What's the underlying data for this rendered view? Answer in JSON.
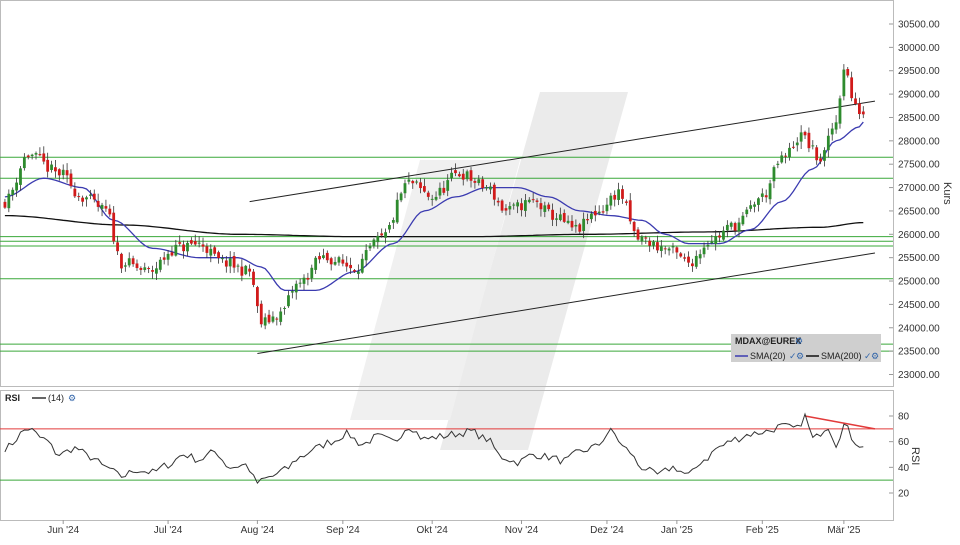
{
  "chart_data": [
    {
      "type": "candlestick",
      "title": "",
      "ylabel": "Kurs",
      "ylim": [
        22700,
        30800
      ],
      "y_ticks": [
        23000,
        23500,
        24000,
        24500,
        25000,
        25500,
        26000,
        26500,
        27000,
        27500,
        28000,
        28500,
        29000,
        29500,
        30000,
        30500
      ],
      "y_tick_labels": [
        "23000.00",
        "23500.00",
        "24000.00",
        "24500.00",
        "25000.00",
        "25500.00",
        "26000.00",
        "26500.00",
        "27000.00",
        "27500.00",
        "28000.00",
        "28500.00",
        "29000.00",
        "29500.00",
        "30000.00",
        "30500.00"
      ],
      "x_labels": [
        "Jun '24",
        "Jul '24",
        "Aug '24",
        "Sep '24",
        "Okt '24",
        "Nov '24",
        "Dez '24",
        "Jan '25",
        "Feb '25",
        "Mär '25"
      ],
      "x_label_day_index": [
        15,
        42,
        65,
        87,
        110,
        133,
        155,
        173,
        195,
        216
      ],
      "close_anchors": [
        [
          0,
          26700
        ],
        [
          6,
          27700
        ],
        [
          14,
          27300
        ],
        [
          20,
          26800
        ],
        [
          26,
          26500
        ],
        [
          30,
          25400
        ],
        [
          37,
          25200
        ],
        [
          44,
          25700
        ],
        [
          50,
          25800
        ],
        [
          56,
          25400
        ],
        [
          63,
          25200
        ],
        [
          66,
          24100
        ],
        [
          71,
          24300
        ],
        [
          75,
          24900
        ],
        [
          82,
          25500
        ],
        [
          90,
          25300
        ],
        [
          97,
          25900
        ],
        [
          104,
          27100
        ],
        [
          110,
          26800
        ],
        [
          117,
          27300
        ],
        [
          124,
          27000
        ],
        [
          129,
          26500
        ],
        [
          136,
          26700
        ],
        [
          141,
          26400
        ],
        [
          147,
          26100
        ],
        [
          153,
          26500
        ],
        [
          158,
          26900
        ],
        [
          163,
          25900
        ],
        [
          170,
          25700
        ],
        [
          176,
          25400
        ],
        [
          182,
          25900
        ],
        [
          188,
          26200
        ],
        [
          195,
          26800
        ],
        [
          200,
          27600
        ],
        [
          205,
          28100
        ],
        [
          210,
          27600
        ],
        [
          214,
          28400
        ],
        [
          216,
          29600
        ],
        [
          219,
          28700
        ],
        [
          221,
          28600
        ]
      ],
      "sma20_anchors": [
        [
          0,
          26800
        ],
        [
          10,
          27200
        ],
        [
          20,
          27000
        ],
        [
          28,
          26300
        ],
        [
          38,
          25700
        ],
        [
          50,
          25500
        ],
        [
          60,
          25500
        ],
        [
          66,
          25300
        ],
        [
          72,
          24800
        ],
        [
          80,
          24800
        ],
        [
          90,
          25200
        ],
        [
          100,
          25800
        ],
        [
          108,
          26500
        ],
        [
          116,
          26800
        ],
        [
          124,
          27000
        ],
        [
          132,
          27000
        ],
        [
          140,
          26800
        ],
        [
          148,
          26500
        ],
        [
          156,
          26400
        ],
        [
          164,
          26300
        ],
        [
          170,
          26000
        ],
        [
          176,
          25800
        ],
        [
          184,
          25800
        ],
        [
          192,
          26100
        ],
        [
          200,
          26700
        ],
        [
          208,
          27400
        ],
        [
          214,
          28000
        ],
        [
          220,
          28300
        ],
        [
          221,
          28400
        ]
      ],
      "sma200_anchors": [
        [
          0,
          26400
        ],
        [
          30,
          26200
        ],
        [
          60,
          26000
        ],
        [
          90,
          25950
        ],
        [
          120,
          25950
        ],
        [
          150,
          26000
        ],
        [
          180,
          26050
        ],
        [
          210,
          26150
        ],
        [
          221,
          26250
        ]
      ],
      "horizontal_levels": [
        27650,
        27200,
        25950,
        25850,
        25750,
        25050,
        23650,
        23500
      ],
      "trendlines": [
        {
          "from": [
            63,
            26700
          ],
          "to": [
            224,
            28850
          ]
        },
        {
          "from": [
            65,
            23450
          ],
          "to": [
            224,
            25600
          ]
        }
      ],
      "candles": 222,
      "legend": {
        "instrument": "MDAX@EUREX",
        "entries": [
          {
            "name": "SMA(20)",
            "color": "#3b3bb0"
          },
          {
            "name": "SMA(200)",
            "color": "#111111"
          }
        ],
        "placement": "bottom-right"
      },
      "colors": {
        "up": "#2e8b2e",
        "down": "#d11a1a",
        "grid_levels": "#3aa83a",
        "trendline": "#222222"
      }
    },
    {
      "type": "line",
      "title": "RSI",
      "series": [
        {
          "name": "(14)",
          "color": "#333333"
        }
      ],
      "ylabel": "RSI",
      "ylim": [
        10,
        93
      ],
      "y_ticks": [
        20,
        40,
        60,
        80
      ],
      "reference_lines": [
        {
          "value": 70,
          "color": "#e23a3a"
        },
        {
          "value": 30,
          "color": "#3aa83a"
        }
      ],
      "divergence_line": {
        "from": [
          206,
          80
        ],
        "to": [
          224,
          70
        ],
        "color": "#e23a3a"
      },
      "rsi_anchors": [
        [
          0,
          55
        ],
        [
          6,
          70
        ],
        [
          10,
          62
        ],
        [
          14,
          50
        ],
        [
          18,
          55
        ],
        [
          22,
          48
        ],
        [
          26,
          40
        ],
        [
          30,
          33
        ],
        [
          34,
          38
        ],
        [
          38,
          36
        ],
        [
          42,
          42
        ],
        [
          46,
          50
        ],
        [
          50,
          46
        ],
        [
          54,
          52
        ],
        [
          58,
          40
        ],
        [
          62,
          42
        ],
        [
          65,
          28
        ],
        [
          68,
          32
        ],
        [
          72,
          38
        ],
        [
          76,
          48
        ],
        [
          80,
          55
        ],
        [
          84,
          60
        ],
        [
          88,
          66
        ],
        [
          92,
          58
        ],
        [
          96,
          64
        ],
        [
          100,
          60
        ],
        [
          104,
          72
        ],
        [
          108,
          62
        ],
        [
          112,
          64
        ],
        [
          116,
          66
        ],
        [
          120,
          68
        ],
        [
          124,
          62
        ],
        [
          128,
          48
        ],
        [
          132,
          44
        ],
        [
          136,
          50
        ],
        [
          140,
          48
        ],
        [
          144,
          45
        ],
        [
          148,
          52
        ],
        [
          152,
          56
        ],
        [
          156,
          68
        ],
        [
          160,
          54
        ],
        [
          164,
          40
        ],
        [
          168,
          34
        ],
        [
          172,
          40
        ],
        [
          176,
          34
        ],
        [
          180,
          46
        ],
        [
          184,
          56
        ],
        [
          188,
          62
        ],
        [
          192,
          66
        ],
        [
          196,
          68
        ],
        [
          200,
          72
        ],
        [
          204,
          70
        ],
        [
          206,
          80
        ],
        [
          208,
          62
        ],
        [
          212,
          72
        ],
        [
          214,
          58
        ],
        [
          216,
          73
        ],
        [
          219,
          60
        ],
        [
          221,
          55
        ]
      ]
    }
  ]
}
